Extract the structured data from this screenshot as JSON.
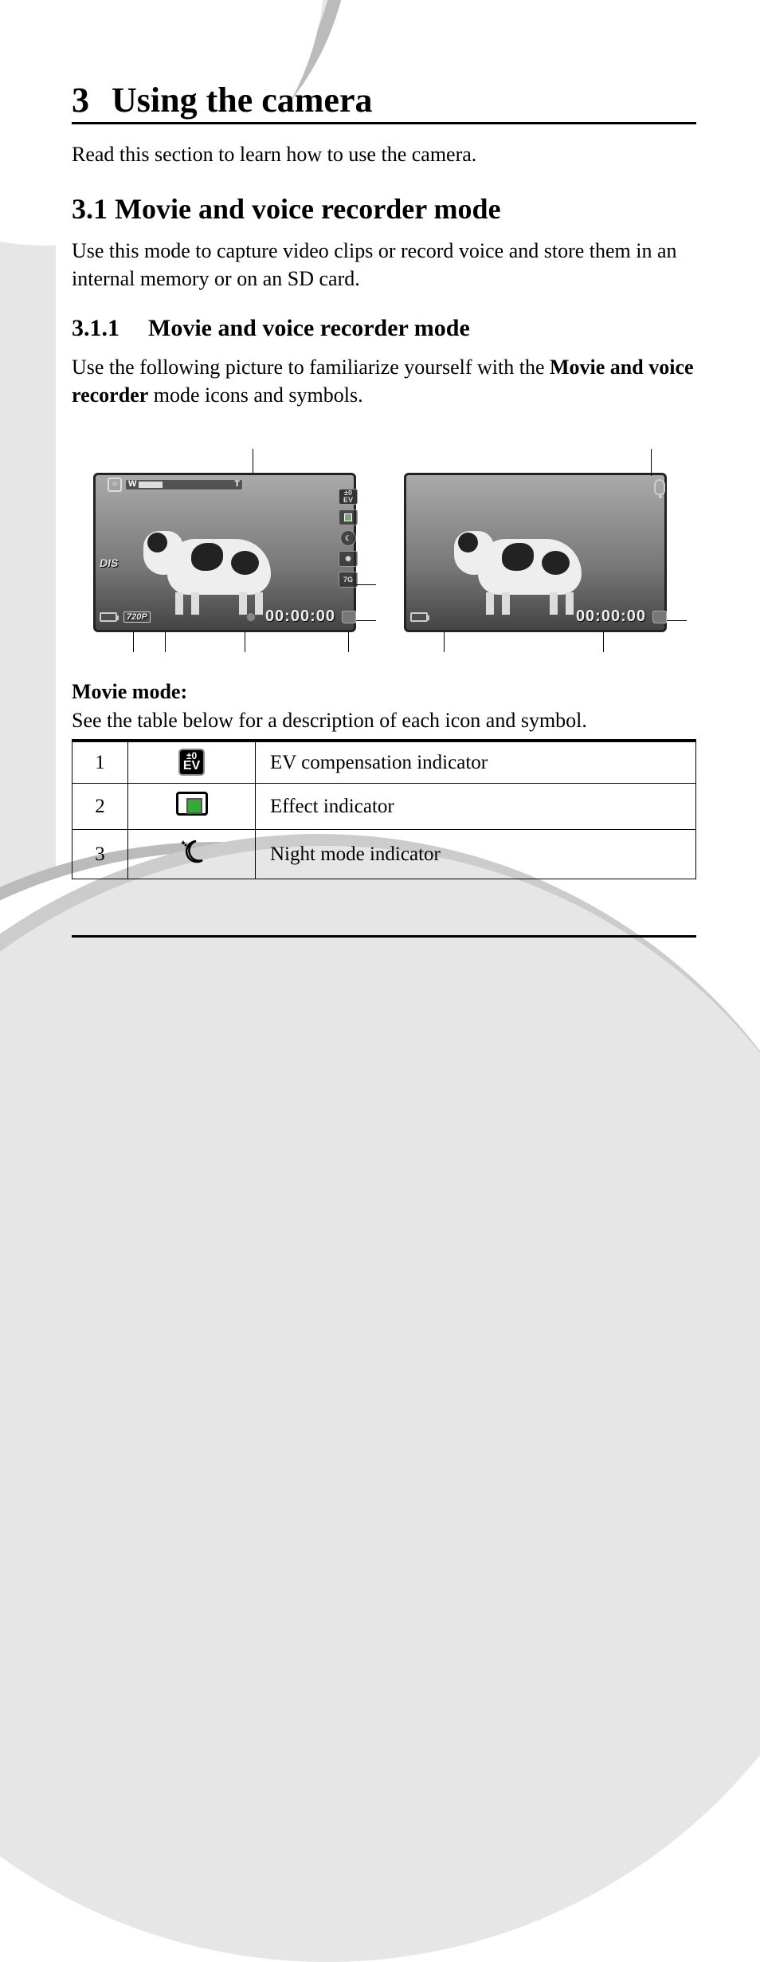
{
  "chapter": {
    "number": "3",
    "title": "Using the camera"
  },
  "intro": "Read this section to learn how to use the camera.",
  "section": {
    "number": "3.1",
    "title": "Movie and voice recorder mode"
  },
  "section_body": "Use this mode to capture video clips or record voice and store them in an internal memory or on an SD card.",
  "subsection": {
    "number": "3.1.1",
    "title": "Movie and voice recorder mode"
  },
  "subsection_body_pre": "Use the following picture to familiarize yourself with the ",
  "subsection_body_bold": "Movie and voice recorder",
  "subsection_body_post": " mode icons and symbols.",
  "movie_screen": {
    "zoom_w": "W",
    "zoom_t": "T",
    "ev_label": "±0\nEV",
    "dis_label": "DIS",
    "resolution": "720P",
    "time": "00:00:00"
  },
  "voice_screen": {
    "time": "00:00:00"
  },
  "movie_mode_heading": "Movie mode:",
  "table_intro": "See the table below for a description of each icon and symbol.",
  "icon_table": [
    {
      "n": "1",
      "desc": "EV compensation indicator"
    },
    {
      "n": "2",
      "desc": "Effect indicator"
    },
    {
      "n": "3",
      "desc": "Night mode indicator"
    }
  ],
  "ev_icon": {
    "top": "±0",
    "bottom": "EV"
  }
}
